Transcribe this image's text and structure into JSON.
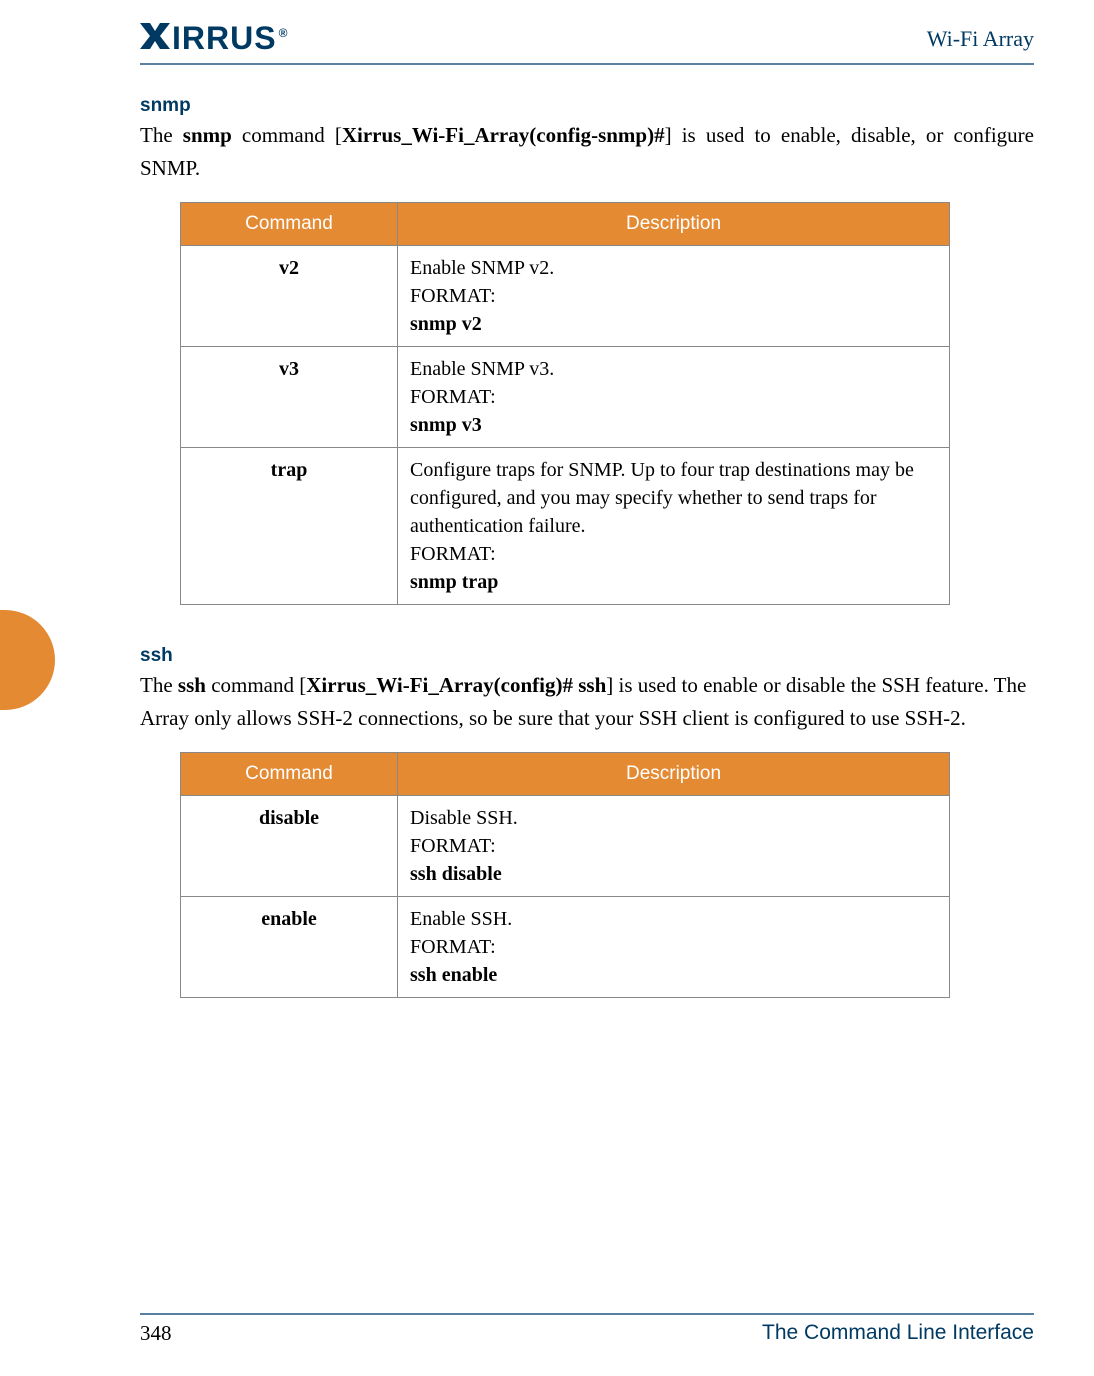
{
  "header": {
    "brand": "XIRRUS",
    "product": "Wi-Fi Array"
  },
  "sections": {
    "snmp": {
      "heading": "snmp",
      "intro_pre": "The ",
      "intro_cmd": "snmp",
      "intro_mid": " command [",
      "intro_prompt": "Xirrus_Wi-Fi_Array(config-snmp)#",
      "intro_post": "] is used to enable, disable, or configure SNMP.",
      "table": {
        "headers": {
          "col1": "Command",
          "col2": "Description"
        },
        "rows": [
          {
            "cmd": "v2",
            "desc": "Enable SNMP v2.",
            "format_label": "FORMAT:",
            "format": "snmp v2"
          },
          {
            "cmd": "v3",
            "desc": "Enable SNMP v3.",
            "format_label": "FORMAT:",
            "format": "snmp v3"
          },
          {
            "cmd": "trap",
            "desc": "Configure traps for SNMP. Up to four trap destinations may be configured, and you may specify whether to send traps for authentication failure.",
            "format_label": "FORMAT:",
            "format": "snmp trap"
          }
        ]
      }
    },
    "ssh": {
      "heading": "ssh",
      "intro_pre": "The ",
      "intro_cmd": "ssh",
      "intro_mid": " command [",
      "intro_prompt": "Xirrus_Wi-Fi_Array(config)# ssh",
      "intro_post": "] is used to enable or disable the SSH feature. The Array only allows SSH-2 connections, so be sure that your SSH client is configured to use SSH-2.",
      "table": {
        "headers": {
          "col1": "Command",
          "col2": "Description"
        },
        "rows": [
          {
            "cmd": "disable",
            "desc": "Disable SSH.",
            "format_label": "FORMAT:",
            "format": "ssh disable"
          },
          {
            "cmd": "enable",
            "desc": "Enable SSH.",
            "format_label": "FORMAT:",
            "format": "ssh enable"
          }
        ]
      }
    }
  },
  "footer": {
    "page": "348",
    "title": "The Command Line Interface"
  }
}
